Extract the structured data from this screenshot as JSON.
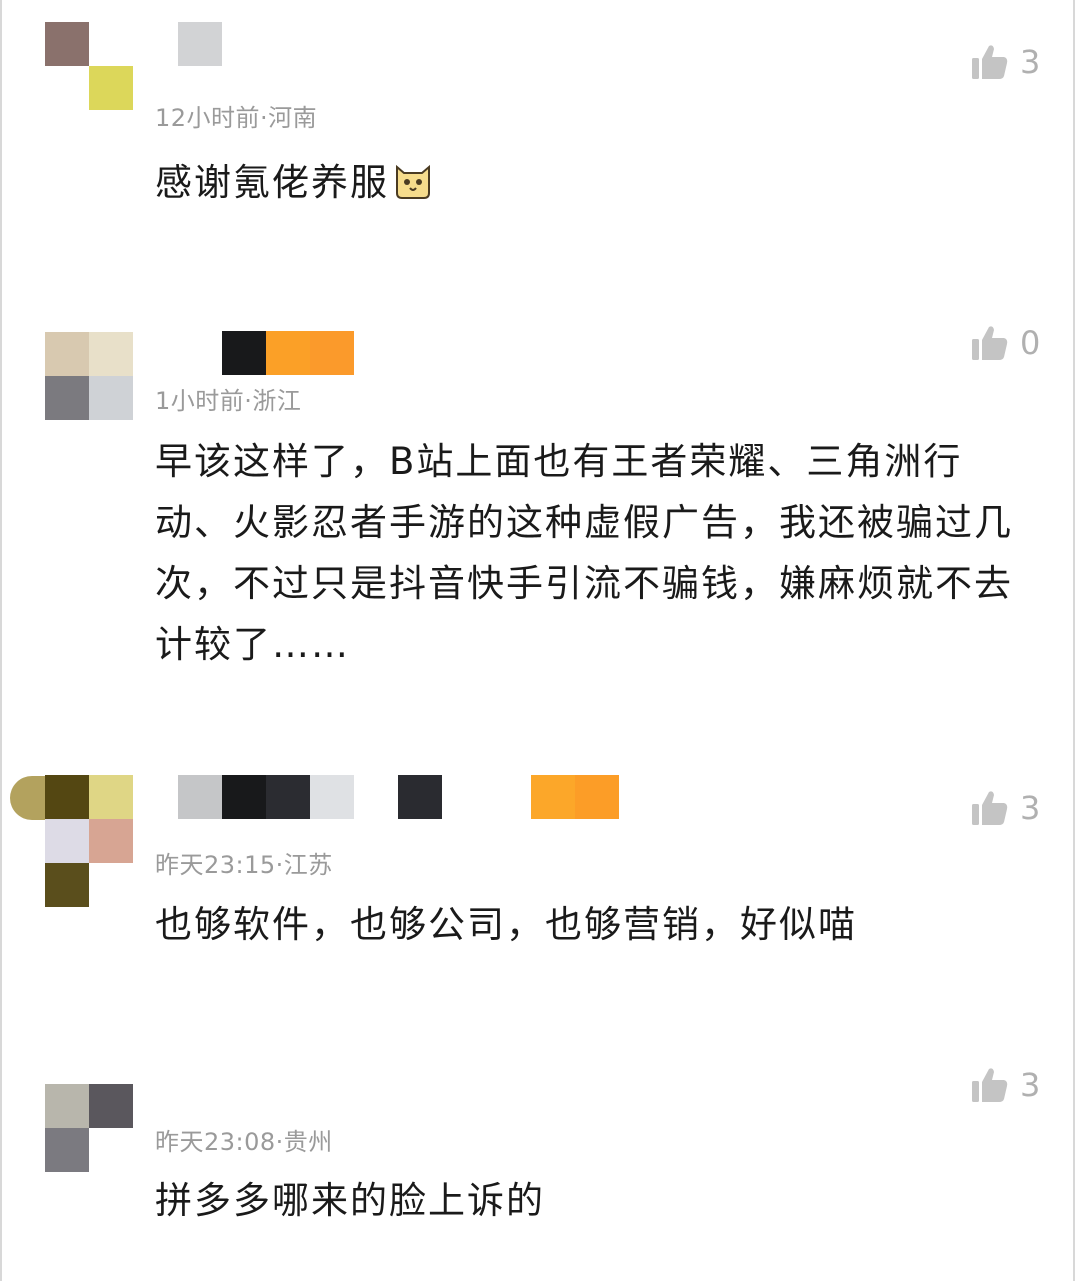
{
  "comments": [
    {
      "meta": "12小时前·河南",
      "text": "感谢氪佬养服",
      "emoji": "cat-face-emoji",
      "likes": "3"
    },
    {
      "meta": "1小时前·浙江",
      "text": "早该这样了，B站上面也有王者荣耀、三角洲行动、火影忍者手游的这种虚假广告，我还被骗过几次，不过只是抖音快手引流不骗钱，嫌麻烦就不去计较了……",
      "likes": "0"
    },
    {
      "meta": "昨天23:15·江苏",
      "text": "也够软件，也够公司，也够营销，好似喵",
      "likes": "3"
    },
    {
      "meta": "昨天23:08·贵州",
      "text": "拼多多哪来的脸上诉的",
      "likes": "3"
    }
  ],
  "icons": {
    "like": "thumbs-up-icon"
  },
  "colors": {
    "meta_text": "#9a9a9a",
    "body_text": "#1a1a1a",
    "like_icon": "#c4c4c4"
  }
}
